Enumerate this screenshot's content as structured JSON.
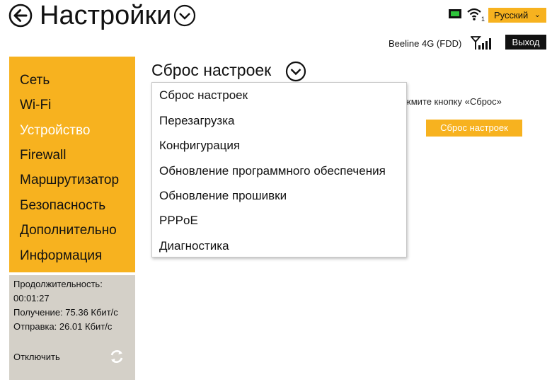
{
  "header": {
    "title": "Настройки",
    "language": "Русский",
    "operator": "Beeline 4G (FDD)",
    "logout_label": "Выход"
  },
  "icons": {
    "back": "back-arrow-icon",
    "title_chevron": "chevron-down-circle-icon",
    "sim": "sim-card-icon",
    "wifi": "wifi-icon",
    "signal": "signal-strength-icon",
    "refresh": "refresh-icon"
  },
  "colors": {
    "accent": "#f7b21f",
    "sidebar_stats_bg": "#d4d0c8",
    "active_nav_text": "#ffffff",
    "logout_bg": "#111111"
  },
  "sidebar": {
    "items": [
      {
        "label": "Сеть",
        "active": false
      },
      {
        "label": "Wi-Fi",
        "active": false
      },
      {
        "label": "Устройство",
        "active": true
      },
      {
        "label": "Firewall",
        "active": false
      },
      {
        "label": "Маршрутизатор",
        "active": false
      },
      {
        "label": "Безопасность",
        "active": false
      },
      {
        "label": "Дополнительно",
        "active": false
      },
      {
        "label": "Информация",
        "active": false
      }
    ],
    "stats": {
      "duration_label": "Продолжительность:",
      "duration_value": "00:01:27",
      "receive": "Получение: 75.36 Кбит/с",
      "send": "Отправка: 26.01 Кбит/с",
      "disconnect_label": "Отключить"
    }
  },
  "main": {
    "section_title": "Сброс настроек",
    "hint_text": "жмите кнопку «Сброс»",
    "reset_button": "Сброс настроек",
    "dropdown": {
      "items": [
        "Сброс настроек",
        "Перезагрузка",
        "Конфигурация",
        "Обновление программного обеспечения",
        "Обновление прошивки",
        "PPPoE",
        "Диагностика"
      ]
    }
  }
}
